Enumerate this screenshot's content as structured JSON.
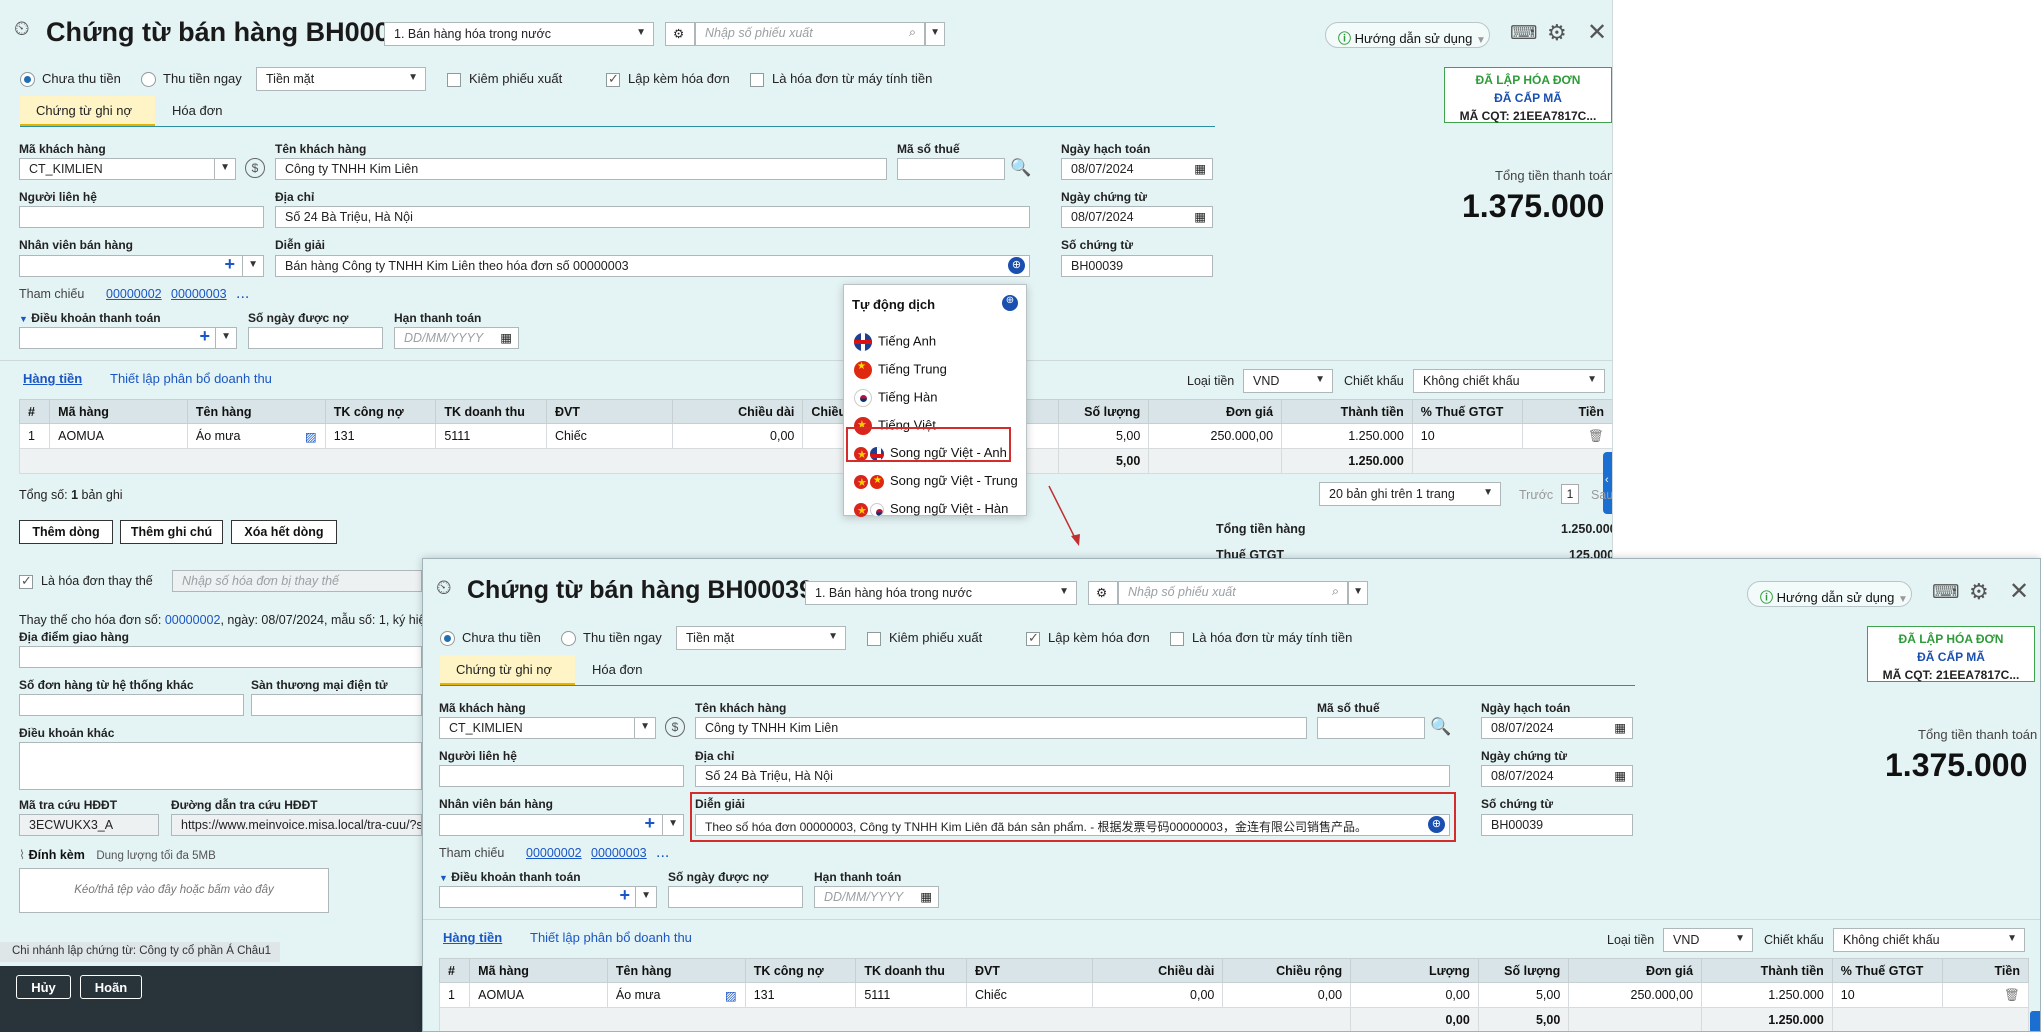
{
  "window1": {
    "title": "Chứng từ bán hàng BH00039",
    "type_select": "1. Bán hàng hóa trong nước",
    "export_slip_placeholder": "Nhập số phiếu xuất",
    "help_label": "Hướng dẫn sử dụng",
    "radio_unpaid": "Chưa thu tiền",
    "radio_paid": "Thu tiền ngay",
    "payment_method": "Tiền mặt",
    "chk_export_slip": "Kiêm phiếu xuất",
    "chk_with_invoice": "Lập kèm hóa đơn",
    "chk_from_cash_register": "Là hóa đơn từ máy tính tiền",
    "tab_debt": "Chứng từ ghi nợ",
    "tab_invoice": "Hóa đơn",
    "stamp_line1": "ĐÃ LẬP HÓA ĐƠN",
    "stamp_line2": "ĐÃ CẤP MÃ",
    "stamp_line3": "MÃ CQT: 21EEA7817C...",
    "customer_code_label": "Mã khách hàng",
    "customer_code": "CT_KIMLIEN",
    "customer_name_label": "Tên khách hàng",
    "customer_name": "Công ty TNHH Kim Liên",
    "tax_code_label": "Mã số thuế",
    "posting_date_label": "Ngày hạch toán",
    "posting_date": "08/07/2024",
    "contact_label": "Người liên hệ",
    "address_label": "Địa chỉ",
    "address": "Số 24 Bà Triệu, Hà Nội",
    "voucher_date_label": "Ngày chứng từ",
    "voucher_date": "08/07/2024",
    "salesperson_label": "Nhân viên bán hàng",
    "description_label": "Diễn giải",
    "description": "Bán hàng Công ty TNHH Kim Liên theo hóa đơn số 00000003",
    "voucher_no_label": "Số chứng từ",
    "voucher_no": "BH00039",
    "total_label": "Tổng tiền thanh toán",
    "total_value": "1.375.000",
    "reference_label": "Tham chiếu",
    "ref1": "00000002",
    "ref2": "00000003",
    "payment_terms_label": "Điều khoản thanh toán",
    "debt_days_label": "Số ngày được nợ",
    "due_date_label": "Hạn thanh toán",
    "due_date_placeholder": "DD/MM/YYYY",
    "tab_goods": "Hàng tiền",
    "revenue_allocation": "Thiết lập phân bổ doanh thu",
    "currency_label": "Loại tiền",
    "currency": "VND",
    "discount_label": "Chiết khấu",
    "discount": "Không chiết khấu",
    "columns": [
      "#",
      "Mã hàng",
      "Tên hàng",
      "TK công nợ",
      "TK doanh thu",
      "ĐVT",
      "Chiều dài",
      "Chiều r",
      "Số lượng",
      "Đơn giá",
      "Thành tiền",
      "% Thuế GTGT",
      "Tiền"
    ],
    "row": [
      "1",
      "AOMUA",
      "Áo mưa",
      "131",
      "5111",
      "Chiếc",
      "0,00",
      "",
      "5,00",
      "250.000,00",
      "1.250.000",
      "10",
      ""
    ],
    "sum_qty": "5,00",
    "sum_amount": "1.250.000",
    "total_rows_prefix": "Tổng số: ",
    "total_rows_count": "1",
    "total_rows_suffix": " bản ghi",
    "page_size": "20 bản ghi trên 1 trang",
    "prev": "Trước",
    "page": "1",
    "next": "Sau",
    "btn_add_row": "Thêm dòng",
    "btn_add_note": "Thêm ghi chú",
    "btn_delete_all": "Xóa hết dòng",
    "goods_total_label": "Tổng tiền hàng",
    "goods_total": "1.250.000",
    "vat_label": "Thuế GTGT",
    "vat_value": "125.000",
    "chk_replacement": "Là hóa đơn thay thế",
    "replaced_placeholder": "Nhập số hóa đơn bị thay thế",
    "replace_for_label": "Thay thế cho hóa đơn số:",
    "replace_for_no": "00000002",
    "replace_for_rest": ", ngày: 08/07/2024, mẫu số: 1, ký hiệ",
    "delivery_place_label": "Địa điểm giao hàng",
    "order_no_label": "Số đơn hàng từ hệ thống khác",
    "marketplace_label": "Sàn thương mại điện tử",
    "other_terms_label": "Điều khoản khác",
    "lookup_code_label": "Mã tra cứu HĐĐT",
    "lookup_code": "3ECWUKX3_A",
    "lookup_url_label": "Đường dẫn tra cứu HĐĐT",
    "lookup_url": "https://www.meinvoice.misa.local/tra-cuu/?s",
    "attach_label": "Đính kèm",
    "attach_limit": "Dung lượng tối đa 5MB",
    "drop_hint": "Kéo/thả tệp vào đây hoặc bấm vào đây",
    "branch": "Chi nhánh lập chứng từ: Công ty cổ phần Á Châu1",
    "btn_cancel": "Hủy",
    "btn_done": "Hoãn"
  },
  "translate_menu": {
    "header": "Tự động dịch",
    "items": [
      {
        "label": "Tiếng Anh",
        "flags": [
          "uk"
        ]
      },
      {
        "label": "Tiếng Trung",
        "flags": [
          "cn"
        ]
      },
      {
        "label": "Tiếng Hàn",
        "flags": [
          "kr"
        ]
      },
      {
        "label": "Tiếng Việt",
        "flags": [
          "vn"
        ]
      },
      {
        "label": "Song ngữ Việt - Anh",
        "flags": [
          "vn",
          "uk"
        ]
      },
      {
        "label": "Song ngữ Việt - Trung",
        "flags": [
          "vn",
          "cn"
        ]
      },
      {
        "label": "Song ngữ Việt - Hàn",
        "flags": [
          "vn",
          "kr"
        ]
      }
    ]
  },
  "window2": {
    "title": "Chứng từ bán hàng BH00039",
    "description": "Theo số hóa đơn 00000003, Công ty TNHH Kim Liên đã bán sản phẩm. - 根据发票号码00000003，金连有限公司销售产品。",
    "columns": [
      "#",
      "Mã hàng",
      "Tên hàng",
      "TK công nợ",
      "TK doanh thu",
      "ĐVT",
      "Chiều dài",
      "Chiều rộng",
      "Lượng",
      "Số lượng",
      "Đơn giá",
      "Thành tiền",
      "% Thuế GTGT",
      "Tiền"
    ],
    "row": [
      "1",
      "AOMUA",
      "Áo mưa",
      "131",
      "5111",
      "Chiếc",
      "0,00",
      "0,00",
      "0,00",
      "5,00",
      "250.000,00",
      "1.250.000",
      "10",
      ""
    ],
    "sum_lượng": "0,00",
    "sum_qty": "5,00",
    "sum_amount": "1.250.000"
  },
  "colors": {
    "background": "#e4f3f4",
    "accent": "#1a56c4",
    "highlight": "#d42b2b",
    "stamp_green": "#2e9b3a"
  }
}
